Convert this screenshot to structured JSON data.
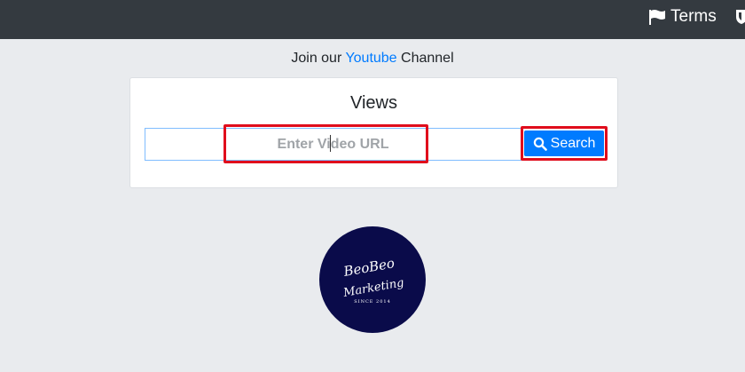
{
  "topbar": {
    "terms_label": "Terms",
    "terms_icon": "flag-icon",
    "extra_icon": "shield-icon"
  },
  "join": {
    "prefix": "Join our",
    "link": "Youtube",
    "suffix": "Channel"
  },
  "card": {
    "title": "Views",
    "input_placeholder": "Enter Video URL",
    "search_label": "Search",
    "search_icon": "search-icon"
  },
  "logo": {
    "line1": "BeoBeo",
    "line2": "Marketing",
    "line3": "SINCE 2014"
  },
  "colors": {
    "topbar": "#343a40",
    "background": "#e9ebee",
    "accent": "#007bff",
    "highlight": "#e00d1c",
    "logo_bg": "#0a0b4a"
  }
}
